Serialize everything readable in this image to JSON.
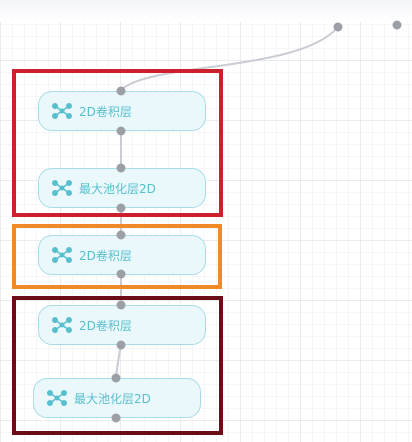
{
  "nodes": [
    {
      "label": "2D卷积层",
      "icon": "network-icon"
    },
    {
      "label": "最大池化层2D",
      "icon": "network-icon"
    },
    {
      "label": "2D卷积层",
      "icon": "network-icon"
    },
    {
      "label": "2D卷积层",
      "icon": "network-icon"
    },
    {
      "label": "最大池化层2D",
      "icon": "network-icon"
    }
  ],
  "colors": {
    "frame_red": "#cf1f2c",
    "frame_orange": "#ee8a2a",
    "frame_dark_red": "#6b0c17",
    "node_text": "#58bfce",
    "node_fill": "#eaf8fb",
    "node_border": "#a7dde6",
    "port": "#9c9fa5",
    "edge": "#c9ccd2"
  }
}
